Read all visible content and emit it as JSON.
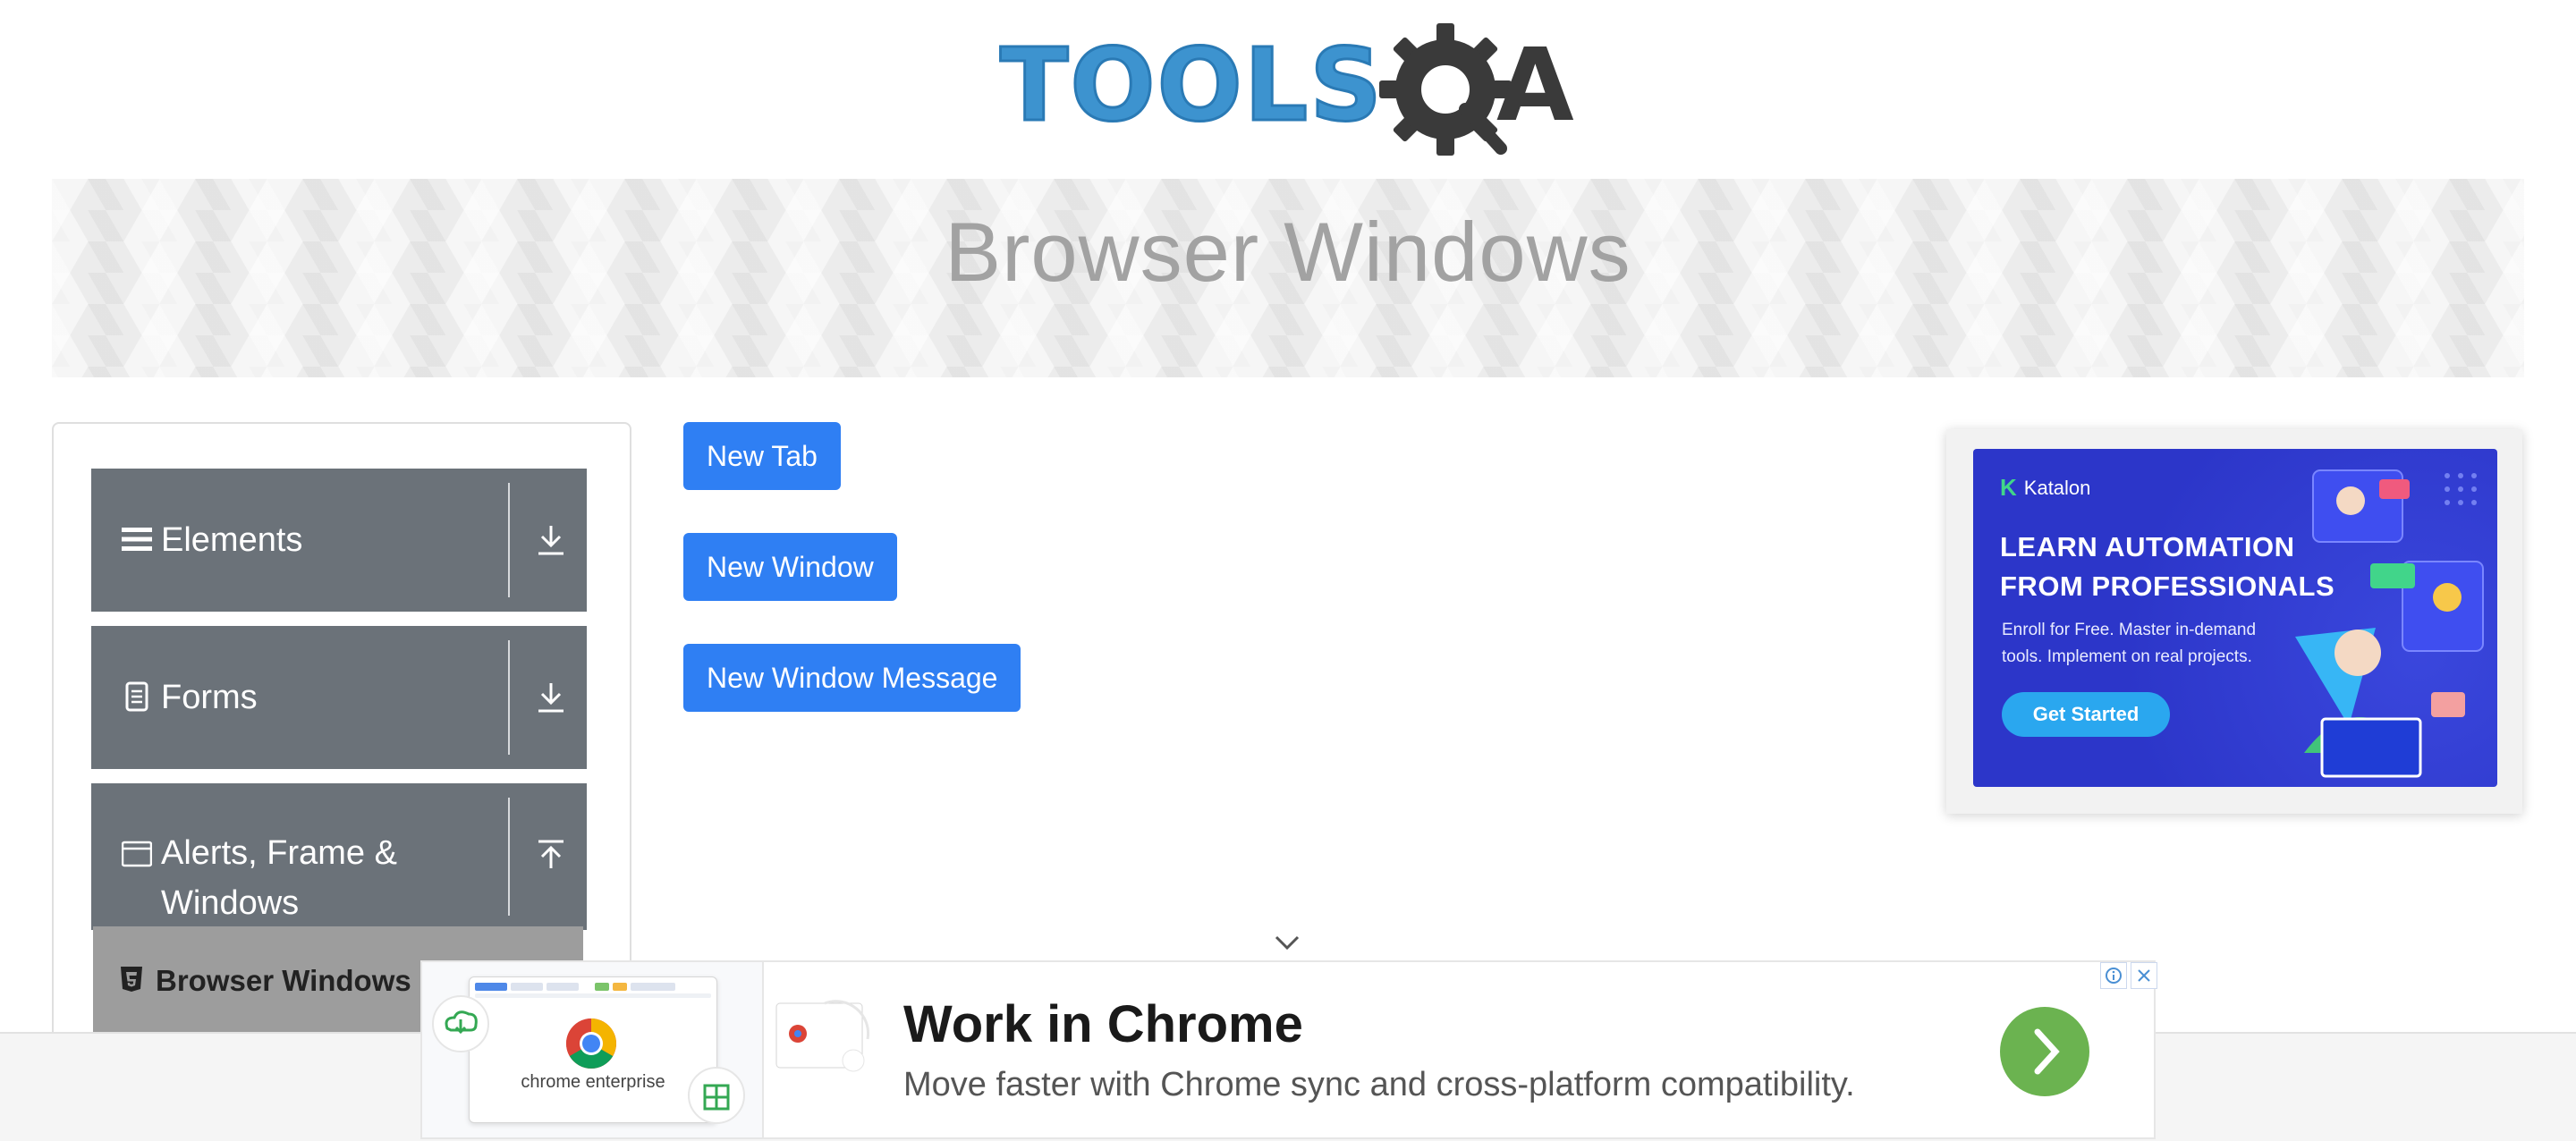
{
  "header": {
    "logo_text": "TOOLS",
    "logo_suffix": "A"
  },
  "banner": {
    "title": "Browser Windows"
  },
  "sidebar": {
    "groups": [
      {
        "label": "Elements",
        "icon": "hamburger-icon",
        "arrow": "download-arrow-icon"
      },
      {
        "label": "Forms",
        "icon": "document-icon",
        "arrow": "download-arrow-icon"
      },
      {
        "label_line1": "Alerts, Frame &",
        "label_line2": "Windows",
        "icon": "window-icon",
        "arrow": "upload-arrow-icon"
      }
    ],
    "active_item": {
      "label": "Browser Windows",
      "icon": "html5-icon"
    }
  },
  "main": {
    "buttons": [
      {
        "label": "New Tab"
      },
      {
        "label": "New Window"
      },
      {
        "label": "New Window Message"
      }
    ]
  },
  "right_ad": {
    "brand": "Katalon",
    "headline_1": "LEARN AUTOMATION",
    "headline_2": "FROM PROFESSIONALS",
    "sub_1": "Enroll for Free. Master in-demand",
    "sub_2": "tools. Implement on real projects.",
    "cta": "Get Started"
  },
  "bottom_ad": {
    "thumb_label": "chrome enterprise",
    "title": "Work in Chrome",
    "subtitle": "Move faster with Chrome sync and cross-platform compatibility.",
    "go_icon": "chevron-right-icon",
    "badges": [
      "info-icon",
      "close-icon"
    ]
  },
  "colors": {
    "primary_button": "#2f7ff3",
    "sidebar_header": "#6b7279",
    "active_item": "#9d9d9d",
    "logo_blue": "#3d93cf",
    "ad_blue": "#2c36c9",
    "go_green": "#6bb350"
  }
}
